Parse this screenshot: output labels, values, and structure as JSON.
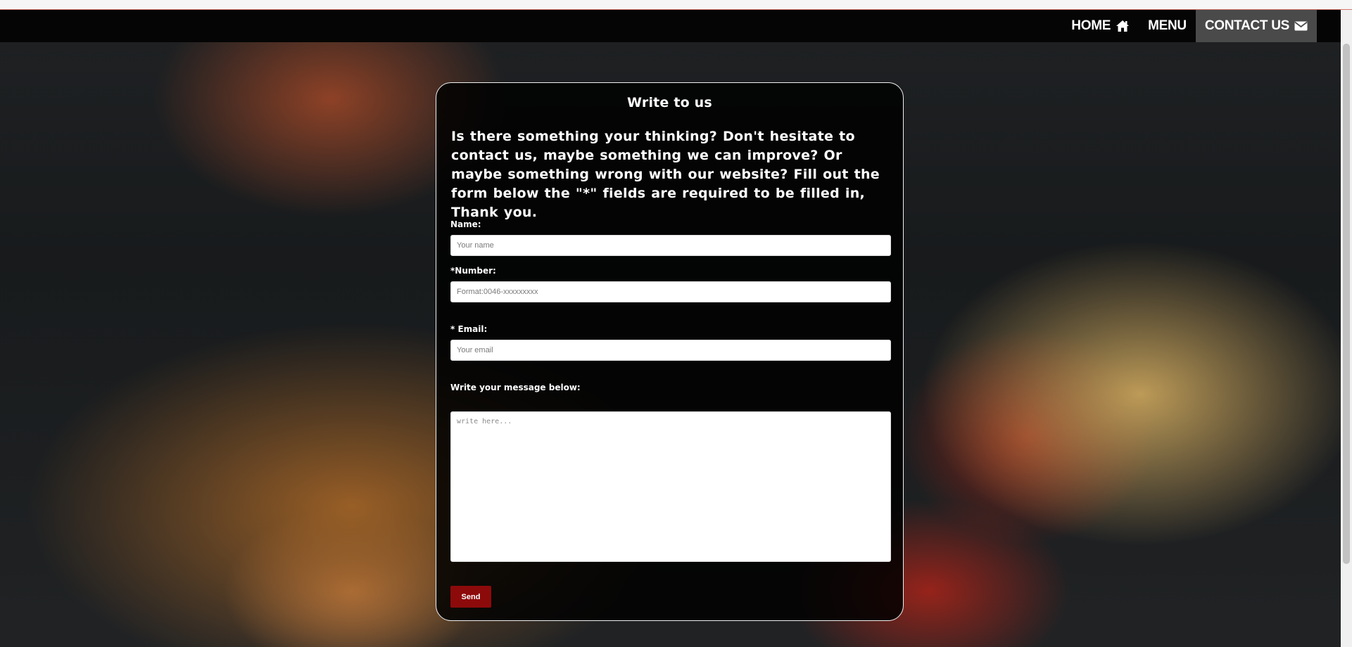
{
  "nav": {
    "items": [
      {
        "label": "HOME",
        "icon": "home-icon",
        "active": false
      },
      {
        "label": "MENU",
        "icon": "",
        "active": false
      },
      {
        "label": "CONTACT US",
        "icon": "envelope-icon",
        "active": true
      }
    ]
  },
  "contact": {
    "title": "Write to us",
    "intro": "Is there something your thinking? Don't hesitate to contact us, maybe something we can improve? Or maybe something wrong with our website? Fill out the form below the \"*\" fields are required to be filled in, Thank you.",
    "fields": {
      "name": {
        "label": "Name:",
        "value": "",
        "placeholder": "Your name"
      },
      "number": {
        "label": "*Number:",
        "value": "",
        "placeholder": "Format:0046-xxxxxxxxx"
      },
      "email": {
        "label": "* Email:",
        "value": "",
        "placeholder": "Your email"
      },
      "message": {
        "label": "Write your message below:",
        "value": "",
        "placeholder": "write here..."
      }
    },
    "send_label": "Send"
  },
  "colors": {
    "navbar": "#050505",
    "active_nav": "#4a4a4a",
    "card_background": "#000000",
    "send_button": "#8d0a0b"
  }
}
